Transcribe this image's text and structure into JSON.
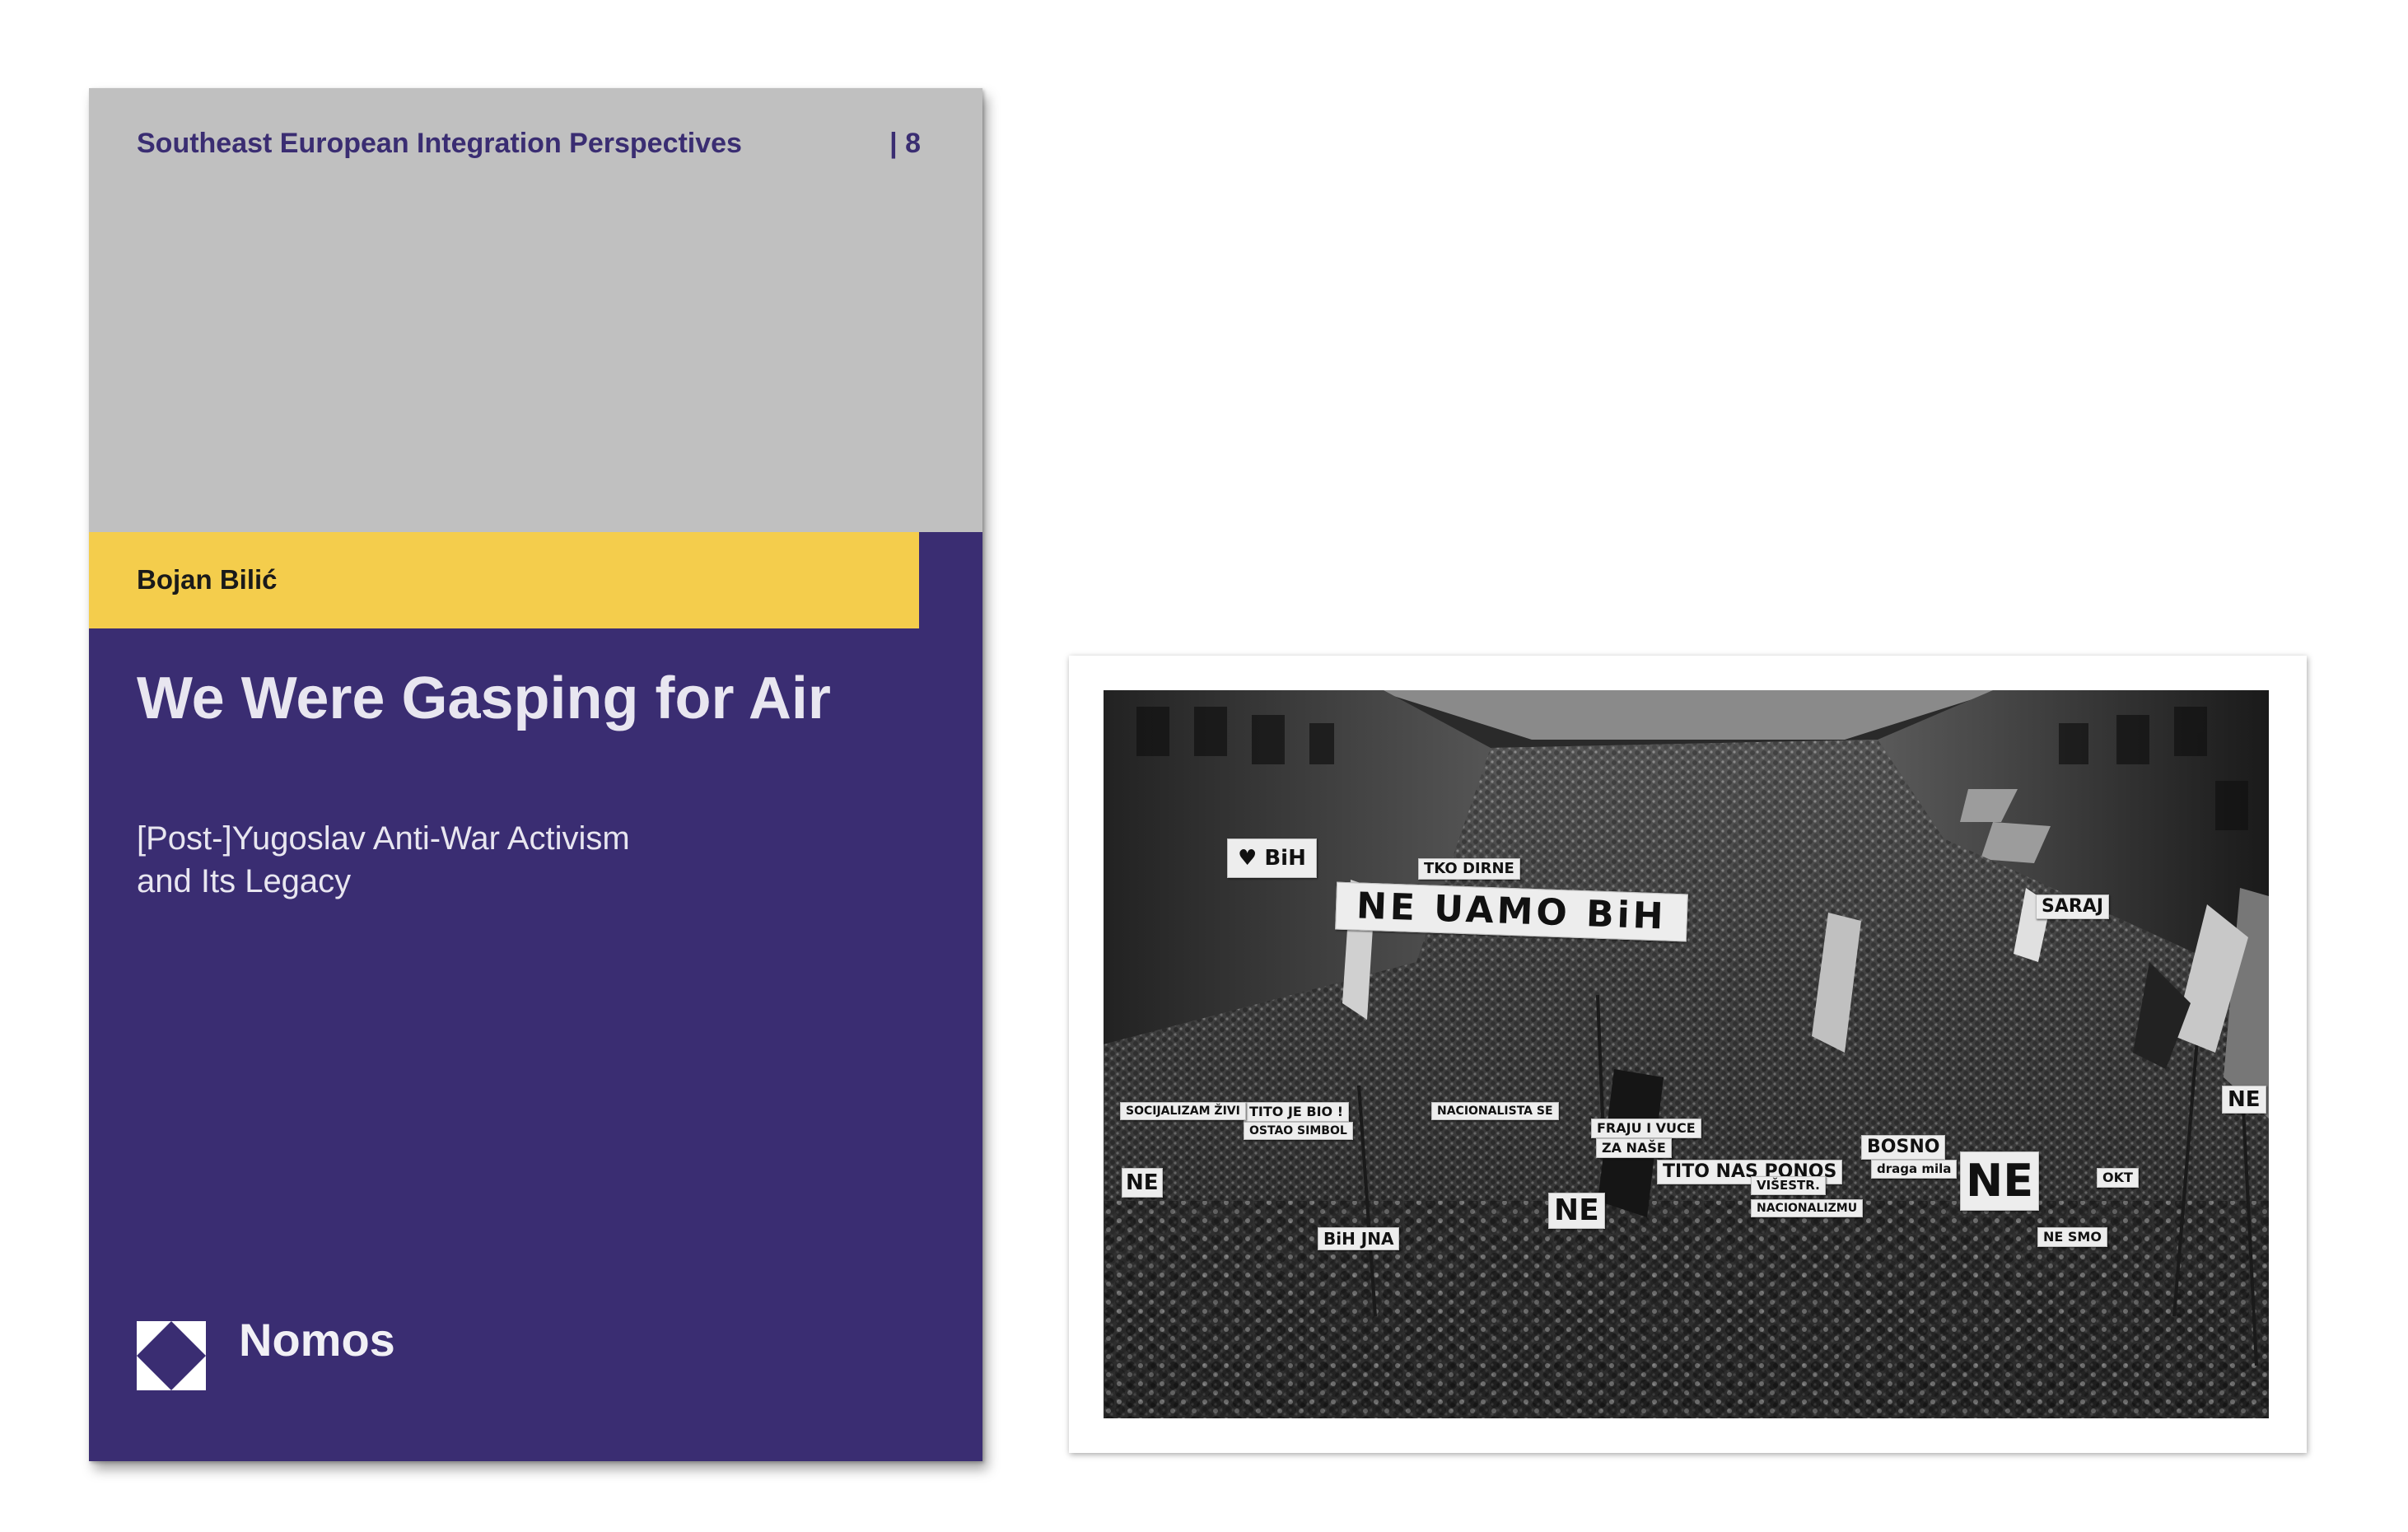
{
  "book_cover": {
    "series_title": "Southeast European Integration Perspectives",
    "series_number": "| 8",
    "author": "Bojan Bilić",
    "title": "We Were Gasping for Air",
    "subtitle_lines": [
      "[Post-]Yugoslav Anti-War Activism",
      "and Its Legacy"
    ],
    "publisher": "Nomos",
    "colors": {
      "band_grey": "#c0c0c0",
      "author_band_yellow": "#f4cd4c",
      "cover_purple": "#3a2d72",
      "text_light": "#e8e6f0"
    },
    "icons": [
      "nomos-logo-icon"
    ]
  },
  "photo": {
    "style": "black-and-white",
    "signs": {
      "main_banner": "NE UAMO BiH",
      "ne_1": "NE",
      "ne_2": "NE",
      "ne_3": "NE",
      "ne_4": "NE",
      "tito_1": "TITO JE BIO !",
      "tito_2": "TITO NAS PONOS",
      "bih_jna": "BiH JNA",
      "tko_dirne": "TKO DIRNE",
      "bosno": "BOSNO",
      "bosno_sub": "draga mila",
      "saraj": "SARAJ",
      "heart_bih": "♥ BiH",
      "nacionalista": "NACIONALISTA SE",
      "fraju": "FRAJU I VUCE",
      "za_nase": "ZA NAŠE",
      "socijalizam": "SOCIJALIZAM ŽIVI",
      "tito_ostao": "OSTAO SIMBOL",
      "viselje": "VIŠESTR.",
      "nacionalizmu": "NACIONALIZMU",
      "ne_smo": "NE SMO",
      "oktobar": "OKT"
    }
  }
}
